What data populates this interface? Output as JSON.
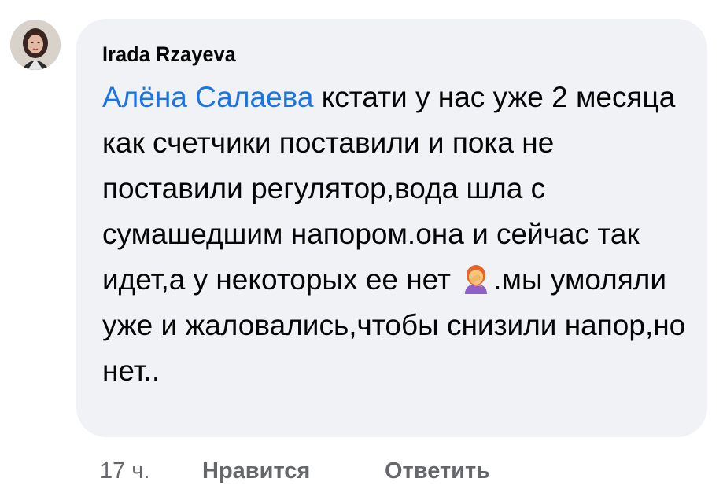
{
  "comment": {
    "author": "Irada Rzayeva",
    "mention": "Алёна Салаева",
    "text_part1": " кстати у нас уже 2 месяца как счетчики поставили и пока не поставили регулятор,вода шла с сумашедшим напором.она и сейчас так идет,а у некоторых ее нет",
    "emoji": "person-facepalming-emoji",
    "text_part2": ".мы умоляли уже и жаловались,чтобы снизили напор,но нет.."
  },
  "meta": {
    "time": "17 ч.",
    "like_label": "Нравится",
    "reply_label": "Ответить"
  },
  "colors": {
    "bubble": "#f0f2f5",
    "mention": "#1b74e4",
    "text": "#050505",
    "meta": "#65676b"
  }
}
